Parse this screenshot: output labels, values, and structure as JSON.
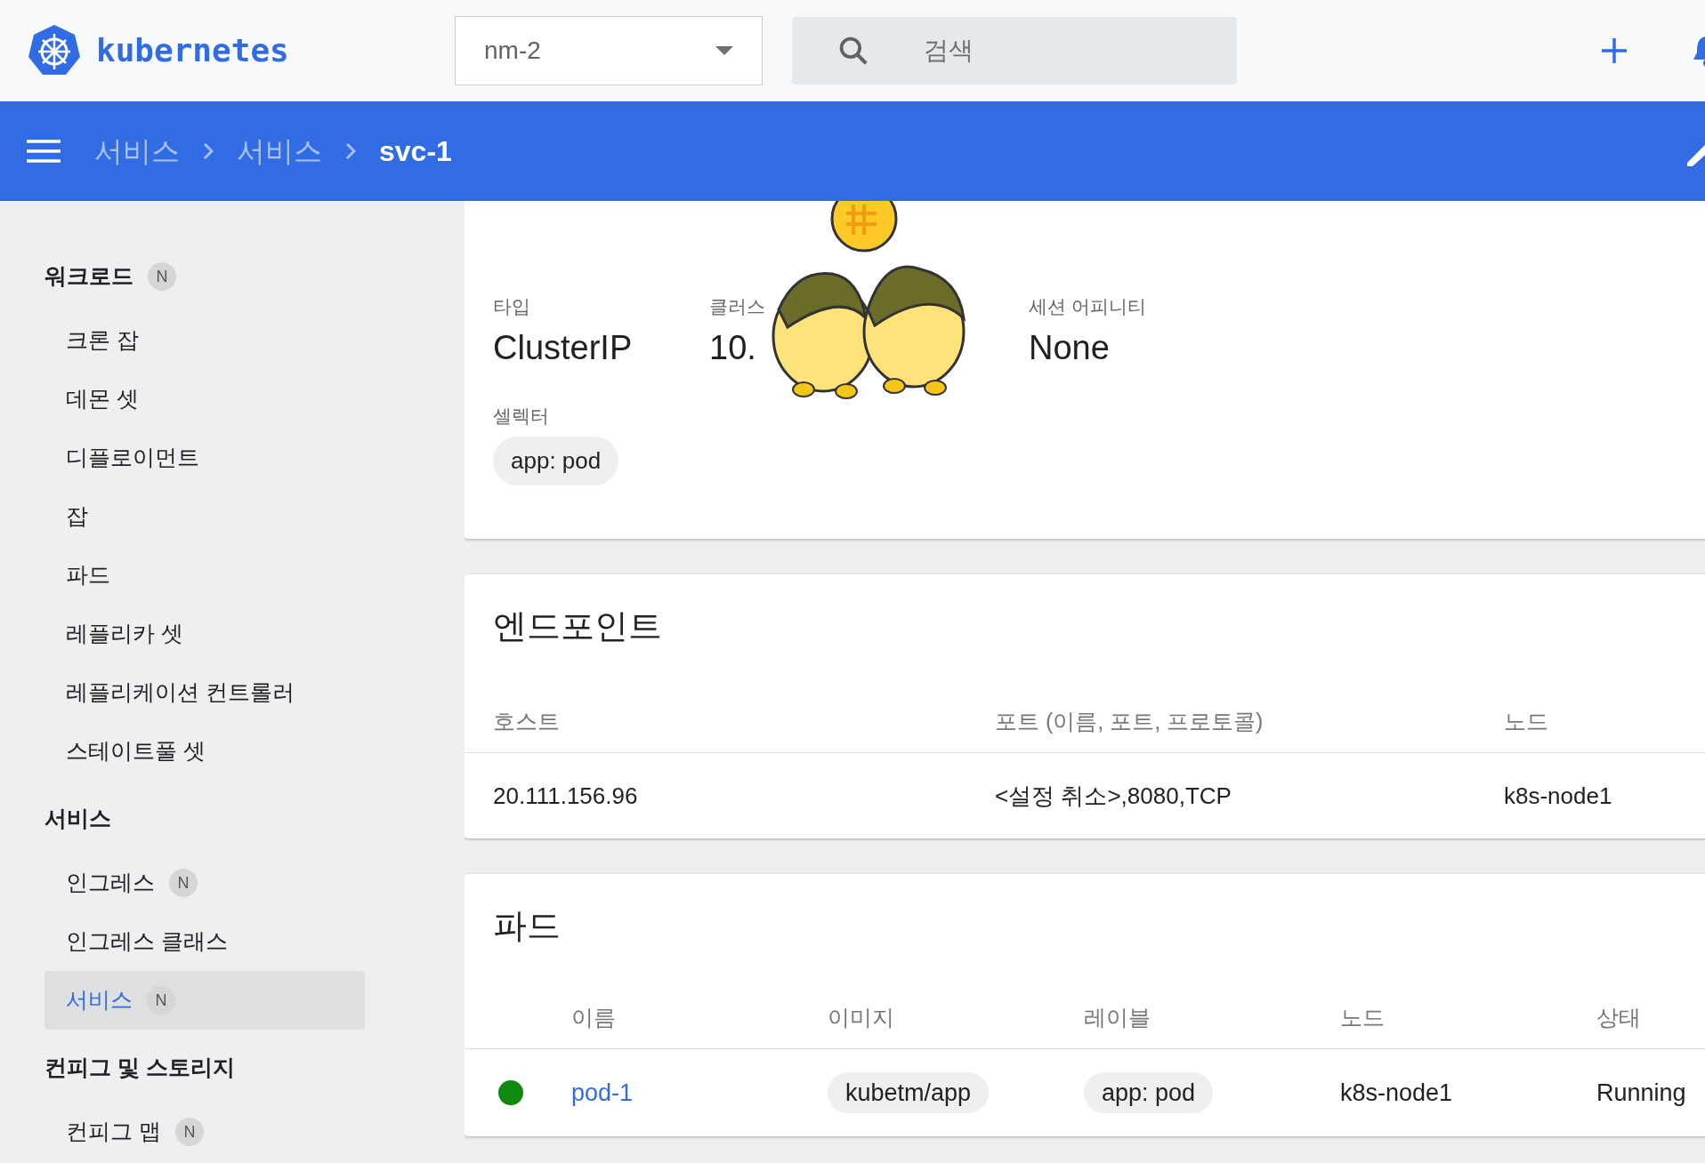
{
  "header": {
    "logo_text": "kubernetes",
    "namespace": "nm-2",
    "search": {
      "placeholder": "검색"
    }
  },
  "breadcrumb": [
    "서비스",
    "서비스",
    "svc-1"
  ],
  "sidebar": {
    "groups": [
      {
        "label": "워크로드",
        "badge": "N",
        "items": [
          {
            "label": "크론 잡",
            "selected": false
          },
          {
            "label": "데몬 셋",
            "selected": false
          },
          {
            "label": "디플로이먼트",
            "selected": false
          },
          {
            "label": "잡",
            "selected": false
          },
          {
            "label": "파드",
            "selected": false
          },
          {
            "label": "레플리카 셋",
            "selected": false
          },
          {
            "label": "레플리케이션 컨트롤러",
            "selected": false
          },
          {
            "label": "스테이트풀 셋",
            "selected": false
          }
        ]
      },
      {
        "label": "서비스",
        "items": [
          {
            "label": "인그레스",
            "badge": "N",
            "selected": false
          },
          {
            "label": "인그레스 클래스",
            "selected": false
          },
          {
            "label": "서비스",
            "badge": "N",
            "selected": true
          }
        ]
      },
      {
        "label": "컨피그 및 스토리지",
        "items": [
          {
            "label": "컨피그 맵",
            "badge": "N",
            "selected": false
          }
        ]
      }
    ]
  },
  "resource_info": {
    "fields": [
      {
        "label": "타입",
        "value": "ClusterIP"
      },
      {
        "label": "클러스",
        "value": "10."
      },
      {
        "label": "세션 어피니티",
        "value": "None"
      }
    ],
    "selector": {
      "label": "셀렉터",
      "chips": [
        "app: pod"
      ]
    }
  },
  "endpoints": {
    "title": "엔드포인트",
    "columns": [
      "호스트",
      "포트 (이름, 포트, 프로토콜)",
      "노드"
    ],
    "rows": [
      [
        "20.111.156.96",
        "<설정 취소>,8080,TCP",
        "k8s-node1"
      ]
    ]
  },
  "pods": {
    "title": "파드",
    "columns": [
      "이름",
      "이미지",
      "레이블",
      "노드",
      "상태"
    ],
    "rows": [
      {
        "color": "#0f8a0f",
        "name": "pod-1",
        "image": "kubetm/app",
        "label": "app: pod",
        "node": "k8s-node1",
        "status": "Running"
      }
    ]
  }
}
